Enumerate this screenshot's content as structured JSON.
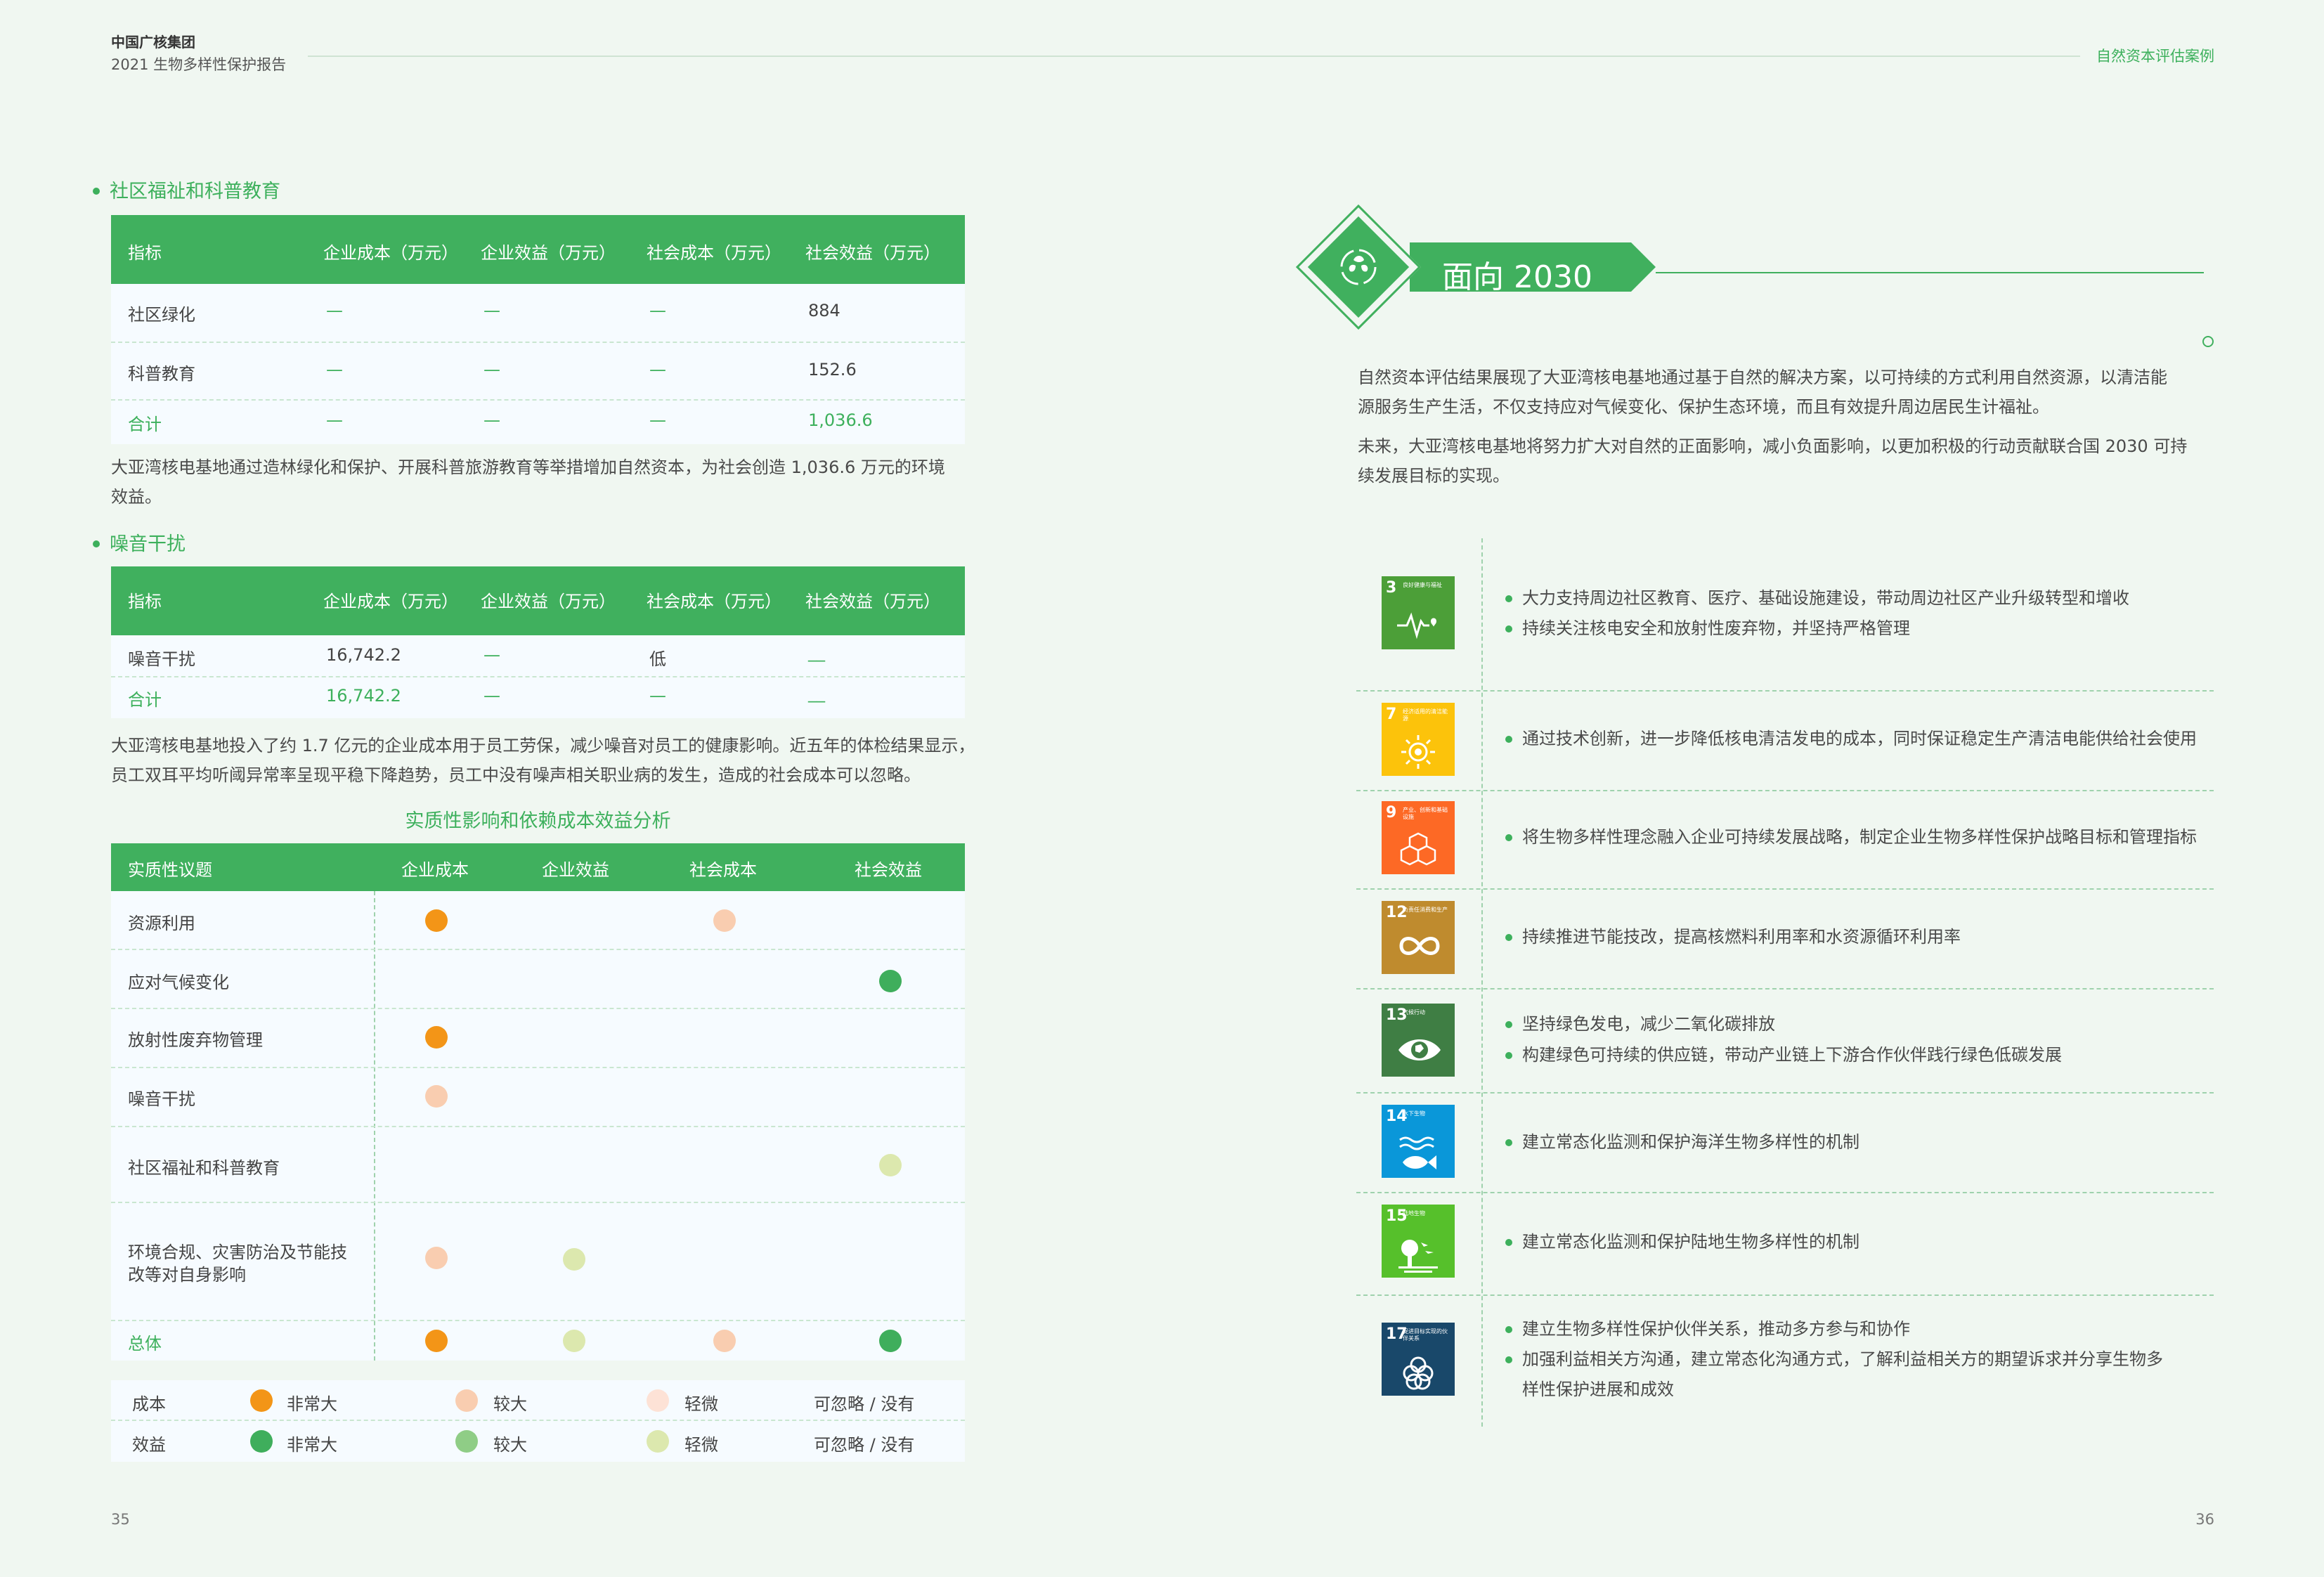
{
  "header": {
    "org": "中国广核集团",
    "report": "2021 生物多样性保护报告",
    "section": "自然资本评估案例"
  },
  "page_left": "35",
  "page_right": "36",
  "community": {
    "title": "社区福祉和科普教育",
    "headers": [
      "指标",
      "企业成本（万元）",
      "企业效益（万元）",
      "社会成本（万元）",
      "社会效益（万元）"
    ],
    "rows": [
      [
        "社区绿化",
        "—",
        "—",
        "—",
        "884"
      ],
      [
        "科普教育",
        "—",
        "—",
        "—",
        "152.6"
      ],
      [
        "合计",
        "—",
        "—",
        "—",
        "1,036.6"
      ]
    ],
    "note_1": "大亚湾核电基地通过造林绿化和保护、开展科普旅游教育等举措增加自然资本，为社会创造 1,036.6 万元的环境",
    "note_2": "效益。"
  },
  "noise": {
    "title": "噪音干扰",
    "headers": [
      "指标",
      "企业成本（万元）",
      "企业效益（万元）",
      "社会成本（万元）",
      "社会效益（万元）"
    ],
    "rows": [
      [
        "噪音干扰",
        "16,742.2",
        "—",
        "低",
        "__"
      ],
      [
        "合计",
        "16,742.2",
        "—",
        "—",
        "__"
      ]
    ],
    "note_1": "大亚湾核电基地投入了约 1.7 亿元的企业成本用于员工劳保，减少噪音对员工的健康影响。近五年的体检结果显示，",
    "note_2": "员工双耳平均听阈异常率呈现平稳下降趋势，员工中没有噪声相关职业病的发生，造成的社会成本可以忽略。"
  },
  "matrix": {
    "title": "实质性影响和依赖成本效益分析",
    "headers": [
      "实质性议题",
      "企业成本",
      "企业效益",
      "社会成本",
      "社会效益"
    ],
    "rows": [
      {
        "label": "资源利用",
        "c1": "orange",
        "c2": "",
        "c3": "peach",
        "c4": ""
      },
      {
        "label": "应对气候变化",
        "c1": "",
        "c2": "",
        "c3": "",
        "c4": "green"
      },
      {
        "label": "放射性废弃物管理",
        "c1": "orange",
        "c2": "",
        "c3": "",
        "c4": ""
      },
      {
        "label": "噪音干扰",
        "c1": "peach",
        "c2": "",
        "c3": "",
        "c4": ""
      },
      {
        "label": "社区福祉和科普教育",
        "c1": "",
        "c2": "",
        "c3": "",
        "c4": "lightgreen"
      },
      {
        "label_1": "环境合规、灾害防治及节能技",
        "label_2": "改等对自身影响",
        "c1": "peach",
        "c2": "lightgreen",
        "c3": "",
        "c4": ""
      },
      {
        "label": "总体",
        "c1": "orange",
        "c2": "lightgreen",
        "c3": "peach",
        "c4": "green"
      }
    ]
  },
  "legend": {
    "cost_label": "成本",
    "benefit_label": "效益",
    "very_large": "非常大",
    "large": "较大",
    "slight": "轻微",
    "negligible": "可忽略 / 没有",
    "colors": {
      "orange": "#f39517",
      "peach": "#f9cdb0",
      "lightpeach": "#fde2d6",
      "green": "#3fae5c",
      "midgreen": "#8fcd86",
      "lightgreen": "#dce8ae"
    }
  },
  "right": {
    "banner": "面向 2030",
    "intro_1": "自然资本评估结果展现了大亚湾核电基地通过基于自然的解决方案，以可持续的方式利用自然资源，以清洁能",
    "intro_2": "源服务生产生活，不仅支持应对气候变化、保护生态环境，而且有效提升周边居民生计福祉。",
    "intro_3": "未来，大亚湾核电基地将努力扩大对自然的正面影响，减小负面影响，以更加积极的行动贡献联合国 2030 可持",
    "intro_4": "续发展目标的实现。",
    "sdgs": [
      {
        "num": "3",
        "label": "良好健康与福祉",
        "color": "#4c9f38",
        "icon": "heartbeat-icon",
        "items": [
          "大力支持周边社区教育、医疗、基础设施建设，带动周边社区产业升级转型和增收",
          "持续关注核电安全和放射性废弃物，并坚持严格管理"
        ]
      },
      {
        "num": "7",
        "label": "经济适用的清洁能源",
        "color": "#fcc30b",
        "icon": "sun-icon",
        "items": [
          "通过技术创新，进一步降低核电清洁发电的成本，同时保证稳定生产清洁电能供给社会使用"
        ]
      },
      {
        "num": "9",
        "label": "产业、创新和基础设施",
        "color": "#fd6925",
        "icon": "cubes-icon",
        "items": [
          "将生物多样性理念融入企业可持续发展战略，制定企业生物多样性保护战略目标和管理指标"
        ]
      },
      {
        "num": "12",
        "label": "负责任消费和生产",
        "color": "#bf8b2e",
        "icon": "infinity-icon",
        "items": [
          "持续推进节能技改，提高核燃料利用率和水资源循环利用率"
        ]
      },
      {
        "num": "13",
        "label": "气候行动",
        "color": "#3f7e44",
        "icon": "eye-globe-icon",
        "items": [
          "坚持绿色发电，减少二氧化碳排放",
          "构建绿色可持续的供应链，带动产业链上下游合作伙伴践行绿色低碳发展"
        ]
      },
      {
        "num": "14",
        "label": "水下生物",
        "color": "#0a97d9",
        "icon": "fish-icon",
        "items": [
          "建立常态化监测和保护海洋生物多样性的机制"
        ]
      },
      {
        "num": "15",
        "label": "陆地生物",
        "color": "#56c02b",
        "icon": "tree-icon",
        "items": [
          "建立常态化监测和保护陆地生物多样性的机制"
        ]
      },
      {
        "num": "17",
        "label": "促进目标实现的伙伴关系",
        "color": "#19486a",
        "icon": "flower-icon",
        "items": [
          "建立生物多样性保护伙伴关系，推动多方参与和协作",
          "加强利益相关方沟通，建立常态化沟通方式，了解利益相关方的期望诉求并分享生物多",
          "样性保护进展和成效"
        ]
      }
    ]
  }
}
